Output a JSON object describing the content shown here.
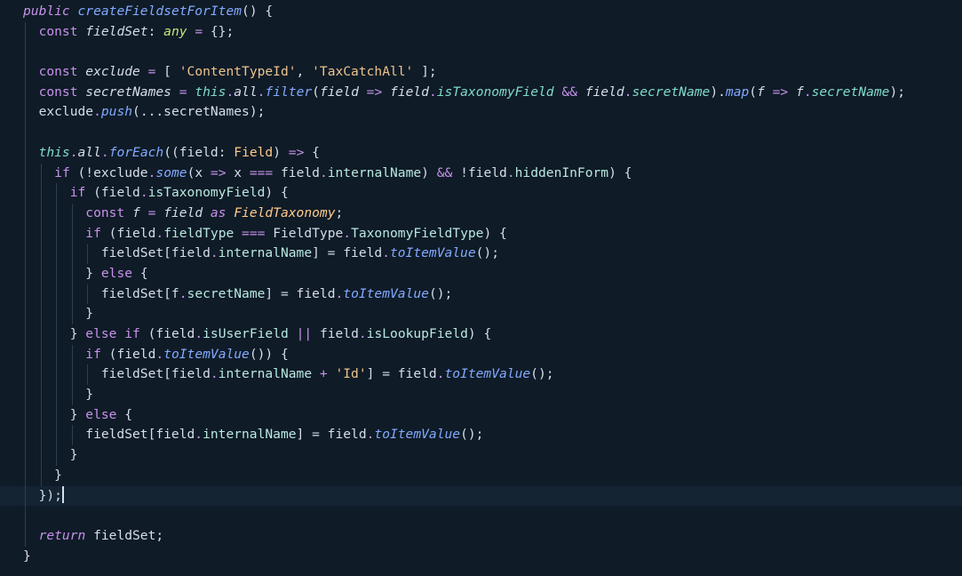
{
  "editor": {
    "background": "#0f1b27",
    "cursor_line": 25,
    "lines": [
      [
        {
          "t": "public ",
          "c": "t-kw-it"
        },
        {
          "t": "createFieldsetForItem",
          "c": "t-fn-it"
        },
        {
          "t": "() {",
          "c": "t-punc"
        }
      ],
      [
        {
          "t": "  const ",
          "c": "t-kw"
        },
        {
          "t": "fieldSet",
          "c": "t-var-it"
        },
        {
          "t": ": ",
          "c": "t-punc"
        },
        {
          "t": "any",
          "c": "t-any"
        },
        {
          "t": " = ",
          "c": "t-op"
        },
        {
          "t": "{};",
          "c": "t-punc"
        }
      ],
      [],
      [
        {
          "t": "  const ",
          "c": "t-kw"
        },
        {
          "t": "exclude",
          "c": "t-var-it"
        },
        {
          "t": " = ",
          "c": "t-op"
        },
        {
          "t": "[ ",
          "c": "t-punc"
        },
        {
          "t": "'ContentTypeId'",
          "c": "t-str"
        },
        {
          "t": ", ",
          "c": "t-punc"
        },
        {
          "t": "'TaxCatchAll'",
          "c": "t-str"
        },
        {
          "t": " ];",
          "c": "t-punc"
        }
      ],
      [
        {
          "t": "  const ",
          "c": "t-kw"
        },
        {
          "t": "secretNames",
          "c": "t-var-it"
        },
        {
          "t": " = ",
          "c": "t-op"
        },
        {
          "t": "this",
          "c": "t-this"
        },
        {
          "t": ".",
          "c": "t-dot"
        },
        {
          "t": "all",
          "c": "t-var-it"
        },
        {
          "t": ".",
          "c": "t-dot"
        },
        {
          "t": "filter",
          "c": "t-call"
        },
        {
          "t": "(",
          "c": "t-punc"
        },
        {
          "t": "field",
          "c": "t-var-it"
        },
        {
          "t": " => ",
          "c": "t-op"
        },
        {
          "t": "field",
          "c": "t-var-it"
        },
        {
          "t": ".",
          "c": "t-dot"
        },
        {
          "t": "isTaxonomyField",
          "c": "t-prop-it"
        },
        {
          "t": " && ",
          "c": "t-op"
        },
        {
          "t": "field",
          "c": "t-var-it"
        },
        {
          "t": ".",
          "c": "t-dot"
        },
        {
          "t": "secretName",
          "c": "t-prop-it"
        },
        {
          "t": ").",
          "c": "t-punc"
        },
        {
          "t": "map",
          "c": "t-call"
        },
        {
          "t": "(",
          "c": "t-punc"
        },
        {
          "t": "f",
          "c": "t-var-it"
        },
        {
          "t": " => ",
          "c": "t-op"
        },
        {
          "t": "f",
          "c": "t-var-it"
        },
        {
          "t": ".",
          "c": "t-dot"
        },
        {
          "t": "secretName",
          "c": "t-prop-it"
        },
        {
          "t": ");",
          "c": "t-punc"
        }
      ],
      [
        {
          "t": "  exclude",
          "c": "t-plain"
        },
        {
          "t": ".",
          "c": "t-dot"
        },
        {
          "t": "push",
          "c": "t-call"
        },
        {
          "t": "(...secretNames);",
          "c": "t-punc"
        }
      ],
      [],
      [
        {
          "t": "  ",
          "c": "t-plain"
        },
        {
          "t": "this",
          "c": "t-this"
        },
        {
          "t": ".",
          "c": "t-dot"
        },
        {
          "t": "all",
          "c": "t-var-it"
        },
        {
          "t": ".",
          "c": "t-dot"
        },
        {
          "t": "forEach",
          "c": "t-call"
        },
        {
          "t": "((field: ",
          "c": "t-punc"
        },
        {
          "t": "Field",
          "c": "t-type"
        },
        {
          "t": ") ",
          "c": "t-punc"
        },
        {
          "t": "=>",
          "c": "t-op"
        },
        {
          "t": " {",
          "c": "t-punc"
        }
      ],
      [
        {
          "t": "    ",
          "c": "t-plain"
        },
        {
          "t": "if",
          "c": "t-kw"
        },
        {
          "t": " (!exclude",
          "c": "t-punc"
        },
        {
          "t": ".",
          "c": "t-dot"
        },
        {
          "t": "some",
          "c": "t-call"
        },
        {
          "t": "(x ",
          "c": "t-punc"
        },
        {
          "t": "=>",
          "c": "t-op"
        },
        {
          "t": " x ",
          "c": "t-punc"
        },
        {
          "t": "===",
          "c": "t-op"
        },
        {
          "t": " field",
          "c": "t-punc"
        },
        {
          "t": ".",
          "c": "t-dot"
        },
        {
          "t": "internalName",
          "c": "t-prop"
        },
        {
          "t": ") ",
          "c": "t-punc"
        },
        {
          "t": "&&",
          "c": "t-op"
        },
        {
          "t": " !field",
          "c": "t-punc"
        },
        {
          "t": ".",
          "c": "t-dot"
        },
        {
          "t": "hiddenInForm",
          "c": "t-prop"
        },
        {
          "t": ") {",
          "c": "t-punc"
        }
      ],
      [
        {
          "t": "      ",
          "c": "t-plain"
        },
        {
          "t": "if",
          "c": "t-kw"
        },
        {
          "t": " (field",
          "c": "t-punc"
        },
        {
          "t": ".",
          "c": "t-dot"
        },
        {
          "t": "isTaxonomyField",
          "c": "t-prop"
        },
        {
          "t": ") {",
          "c": "t-punc"
        }
      ],
      [
        {
          "t": "        const ",
          "c": "t-kw"
        },
        {
          "t": "f",
          "c": "t-var-it"
        },
        {
          "t": " = ",
          "c": "t-op"
        },
        {
          "t": "field",
          "c": "t-var-it"
        },
        {
          "t": " as ",
          "c": "t-kw-it"
        },
        {
          "t": "FieldTaxonomy",
          "c": "t-type-it"
        },
        {
          "t": ";",
          "c": "t-punc"
        }
      ],
      [
        {
          "t": "        ",
          "c": "t-plain"
        },
        {
          "t": "if",
          "c": "t-kw"
        },
        {
          "t": " (field",
          "c": "t-punc"
        },
        {
          "t": ".",
          "c": "t-dot"
        },
        {
          "t": "fieldType",
          "c": "t-prop"
        },
        {
          "t": " === ",
          "c": "t-op"
        },
        {
          "t": "FieldType",
          "c": "t-plain"
        },
        {
          "t": ".",
          "c": "t-dot"
        },
        {
          "t": "TaxonomyFieldType",
          "c": "t-prop"
        },
        {
          "t": ") {",
          "c": "t-punc"
        }
      ],
      [
        {
          "t": "          fieldSet[field",
          "c": "t-punc"
        },
        {
          "t": ".",
          "c": "t-dot"
        },
        {
          "t": "internalName",
          "c": "t-prop"
        },
        {
          "t": "] = field",
          "c": "t-punc"
        },
        {
          "t": ".",
          "c": "t-dot"
        },
        {
          "t": "toItemValue",
          "c": "t-call"
        },
        {
          "t": "();",
          "c": "t-punc"
        }
      ],
      [
        {
          "t": "        } ",
          "c": "t-punc"
        },
        {
          "t": "else",
          "c": "t-kw"
        },
        {
          "t": " {",
          "c": "t-punc"
        }
      ],
      [
        {
          "t": "          fieldSet[f",
          "c": "t-punc"
        },
        {
          "t": ".",
          "c": "t-dot"
        },
        {
          "t": "secretName",
          "c": "t-prop"
        },
        {
          "t": "] = field",
          "c": "t-punc"
        },
        {
          "t": ".",
          "c": "t-dot"
        },
        {
          "t": "toItemValue",
          "c": "t-call"
        },
        {
          "t": "();",
          "c": "t-punc"
        }
      ],
      [
        {
          "t": "        }",
          "c": "t-punc"
        }
      ],
      [
        {
          "t": "      } ",
          "c": "t-punc"
        },
        {
          "t": "else if",
          "c": "t-kw"
        },
        {
          "t": " (field",
          "c": "t-punc"
        },
        {
          "t": ".",
          "c": "t-dot"
        },
        {
          "t": "isUserField",
          "c": "t-prop"
        },
        {
          "t": " || ",
          "c": "t-op"
        },
        {
          "t": "field",
          "c": "t-punc"
        },
        {
          "t": ".",
          "c": "t-dot"
        },
        {
          "t": "isLookupField",
          "c": "t-prop"
        },
        {
          "t": ") {",
          "c": "t-punc"
        }
      ],
      [
        {
          "t": "        ",
          "c": "t-plain"
        },
        {
          "t": "if",
          "c": "t-kw"
        },
        {
          "t": " (field",
          "c": "t-punc"
        },
        {
          "t": ".",
          "c": "t-dot"
        },
        {
          "t": "toItemValue",
          "c": "t-call"
        },
        {
          "t": "()) {",
          "c": "t-punc"
        }
      ],
      [
        {
          "t": "          fieldSet[field",
          "c": "t-punc"
        },
        {
          "t": ".",
          "c": "t-dot"
        },
        {
          "t": "internalName",
          "c": "t-prop"
        },
        {
          "t": " + ",
          "c": "t-op"
        },
        {
          "t": "'Id'",
          "c": "t-str"
        },
        {
          "t": "] = field",
          "c": "t-punc"
        },
        {
          "t": ".",
          "c": "t-dot"
        },
        {
          "t": "toItemValue",
          "c": "t-call"
        },
        {
          "t": "();",
          "c": "t-punc"
        }
      ],
      [
        {
          "t": "        }",
          "c": "t-punc"
        }
      ],
      [
        {
          "t": "      } ",
          "c": "t-punc"
        },
        {
          "t": "else",
          "c": "t-kw"
        },
        {
          "t": " {",
          "c": "t-punc"
        }
      ],
      [
        {
          "t": "        fieldSet[field",
          "c": "t-punc"
        },
        {
          "t": ".",
          "c": "t-dot"
        },
        {
          "t": "internalName",
          "c": "t-prop"
        },
        {
          "t": "] = field",
          "c": "t-punc"
        },
        {
          "t": ".",
          "c": "t-dot"
        },
        {
          "t": "toItemValue",
          "c": "t-call"
        },
        {
          "t": "();",
          "c": "t-punc"
        }
      ],
      [
        {
          "t": "      }",
          "c": "t-punc"
        }
      ],
      [
        {
          "t": "    }",
          "c": "t-punc"
        }
      ],
      [
        {
          "t": "  });",
          "c": "t-punc"
        }
      ],
      [],
      [
        {
          "t": "  ",
          "c": "t-plain"
        },
        {
          "t": "return",
          "c": "t-kw-it"
        },
        {
          "t": " fieldSet;",
          "c": "t-punc"
        }
      ],
      [
        {
          "t": "}",
          "c": "t-punc"
        }
      ]
    ]
  }
}
